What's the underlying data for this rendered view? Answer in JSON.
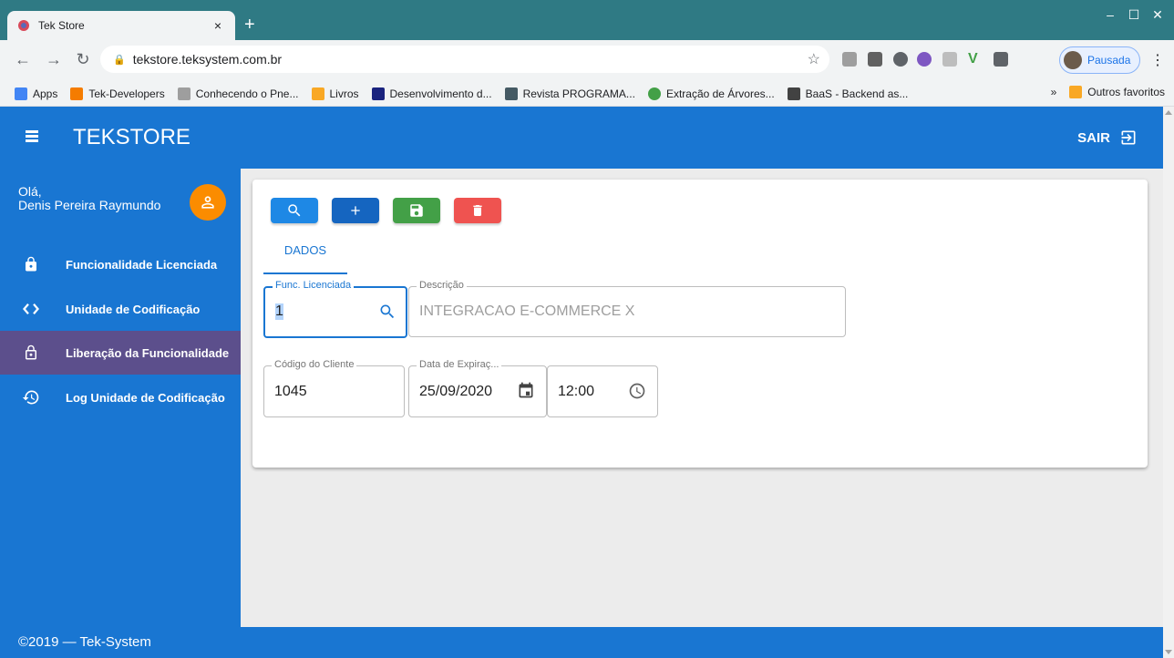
{
  "browser": {
    "tab_title": "Tek Store",
    "tab_close": "×",
    "new_tab": "+",
    "url": "tekstore.teksystem.com.br",
    "profile_label": "Pausada",
    "bookmarks": [
      {
        "label": "Apps",
        "color": "#4285f4"
      },
      {
        "label": "Tek-Developers",
        "color": "#f57c00"
      },
      {
        "label": "Conhecendo o Pne...",
        "color": "#9e9e9e"
      },
      {
        "label": "Livros",
        "color": "#f9a825"
      },
      {
        "label": "Desenvolvimento d...",
        "color": "#1a237e"
      },
      {
        "label": "Revista PROGRAMA...",
        "color": "#455a64"
      },
      {
        "label": "Extração de Árvores...",
        "color": "#43a047"
      },
      {
        "label": "BaaS - Backend as...",
        "color": "#424242"
      }
    ],
    "bookmarks_more": "»",
    "other_bookmarks": "Outros favoritos"
  },
  "app": {
    "title": "TEKSTORE",
    "logout_label": "SAIR",
    "greeting_line1": "Olá,",
    "greeting_line2": "Denis Pereira Raymundo",
    "nav": [
      {
        "label": "Funcionalidade Licenciada",
        "icon": "lock-icon"
      },
      {
        "label": "Unidade de Codificação",
        "icon": "code-icon"
      },
      {
        "label": "Liberação da Funcionalidade",
        "icon": "lock-open-icon"
      },
      {
        "label": "Log Unidade de Codificação",
        "icon": "history-icon"
      }
    ],
    "footer": "©2019 — Tek-System",
    "colors": {
      "primary": "#1976d2",
      "active_nav": "#5c4f8c",
      "avatar": "#fb8c00",
      "search": "#1e88e5",
      "add": "#1565c0",
      "save": "#43a047",
      "delete": "#ef5350"
    }
  },
  "form": {
    "tab_label": "DADOS",
    "func_label": "Func. Licenciada",
    "func_value": "1",
    "descricao_label": "Descrição",
    "descricao_value": "INTEGRACAO E-COMMERCE X",
    "cliente_label": "Código do Cliente",
    "cliente_value": "1045",
    "data_label": "Data de Expiraç...",
    "data_value": "25/09/2020",
    "hora_value": "12:00"
  }
}
